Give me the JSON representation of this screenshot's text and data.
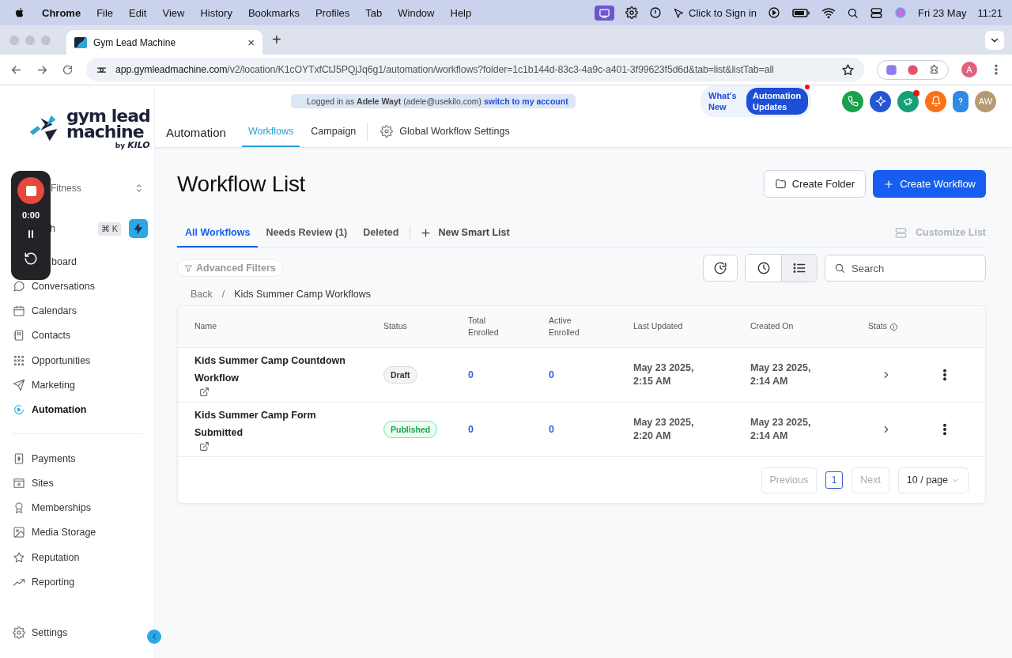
{
  "menubar": {
    "app": "Chrome",
    "menus": [
      "File",
      "Edit",
      "View",
      "History",
      "Bookmarks",
      "Profiles",
      "Tab",
      "Window",
      "Help"
    ],
    "sign_in": "Click to Sign in",
    "date": "Fri 23 May",
    "time": "11:21"
  },
  "browser": {
    "tab_title": "Gym Lead Machine",
    "tab_close": "×",
    "new_tab": "+",
    "url_host": "app.gymleadmachine.com",
    "url_path": "/v2/location/K1cOYTxfCtJ5PQjJq6g1/automation/workflows?folder=1c1b144d-83c3-4a9c-a401-3f99623f5d6d&tab=list&listTab=all",
    "profile": "A"
  },
  "recorder": {
    "time": "0:00"
  },
  "sidebar": {
    "logo": {
      "line1": "gym lead",
      "line2": "machine",
      "by": "by",
      "brand": "KILO"
    },
    "location": "Fitness",
    "search": {
      "label": "h",
      "shortcut": "⌘ K"
    },
    "items": [
      {
        "label": "board",
        "selected": false
      },
      {
        "label": "Conversations",
        "selected": false
      },
      {
        "label": "Calendars",
        "selected": false
      },
      {
        "label": "Contacts",
        "selected": false
      },
      {
        "label": "Opportunities",
        "selected": false
      },
      {
        "label": "Marketing",
        "selected": false
      },
      {
        "label": "Automation",
        "selected": true
      }
    ],
    "items_2": [
      {
        "label": "Payments",
        "selected": false
      },
      {
        "label": "Sites",
        "selected": false
      },
      {
        "label": "Memberships",
        "selected": false
      },
      {
        "label": "Media Storage",
        "selected": false
      },
      {
        "label": "Reputation",
        "selected": false
      },
      {
        "label": "Reporting",
        "selected": false
      }
    ],
    "settings": {
      "label": "Settings",
      "selected": false
    }
  },
  "header": {
    "banner": "Logged in as **Adele Wayt** (adele@usekilo.com)",
    "banner_link": "switch to my account",
    "whats_new": "What's New",
    "updates": "Automation Updates",
    "avatar": "AW",
    "title": "Automation",
    "tabs": [
      {
        "label": "Workflows",
        "selected": true
      },
      {
        "label": "Campaign",
        "selected": false
      },
      {
        "label": "Global Workflow Settings",
        "selected": false
      }
    ]
  },
  "page": {
    "title": "Workflow List",
    "buttons": [
      "Create Folder",
      "Create Workflow"
    ],
    "tabs": [
      {
        "label": "All Workflows",
        "selected": true
      },
      {
        "label": "Needs Review (1)",
        "selected": false
      },
      {
        "label": "Deleted",
        "selected": false
      }
    ],
    "new_smart_list": "New Smart List",
    "customize": {
      "label": "Customize List",
      "disabled": true
    },
    "filters": "Advanced Filters",
    "views": [
      {
        "selected": false
      },
      {
        "selected": true
      }
    ],
    "search": {
      "placeholder": "Search"
    },
    "breadcrumb": {
      "back": "Back",
      "separator": "/",
      "current": "Kids Summer Camp Workflows"
    },
    "table": {
      "columns": [
        "Name",
        "Status",
        "Total Enrolled",
        "Active Enrolled",
        "Last Updated",
        "Created On",
        "Stats"
      ],
      "rows": [
        {
          "name": "Kids Summer Camp Countdown Workflow",
          "status": {
            "label": "Draft",
            "kind": "draft"
          },
          "total": "0",
          "active": "0",
          "updated": "May 23 2025, 2:15 AM",
          "created": "May 23 2025, 2:14 AM"
        },
        {
          "name": "Kids Summer Camp Form Submitted",
          "status": {
            "label": "Published",
            "kind": "published"
          },
          "total": "0",
          "active": "0",
          "updated": "May 23 2025, 2:20 AM",
          "created": "May 23 2025, 2:14 AM"
        }
      ]
    },
    "pagination": {
      "previous": {
        "label": "Previous",
        "disabled": true
      },
      "page": "1",
      "next": {
        "label": "Next",
        "disabled": true
      },
      "per_page": "10 / page"
    }
  }
}
